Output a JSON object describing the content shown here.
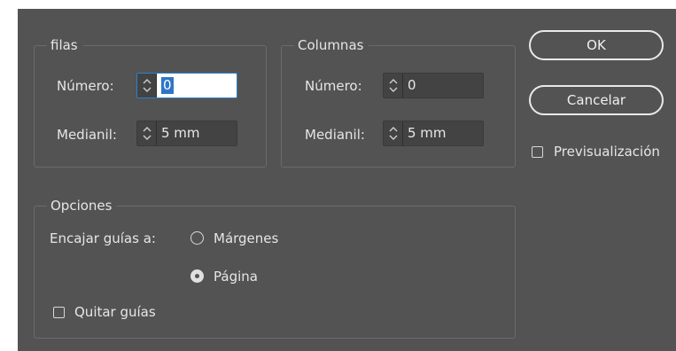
{
  "rows_group": {
    "legend": "filas",
    "number_label": "Número:",
    "number_value": "0",
    "gutter_label": "Medianil:",
    "gutter_value": "5 mm"
  },
  "columns_group": {
    "legend": "Columnas",
    "number_label": "Número:",
    "number_value": "0",
    "gutter_label": "Medianil:",
    "gutter_value": "5 mm"
  },
  "buttons": {
    "ok": "OK",
    "cancel": "Cancelar"
  },
  "preview": {
    "label": "Previsualización",
    "checked": false
  },
  "options": {
    "legend": "Opciones",
    "fit_label": "Encajar guías a:",
    "fit_options": [
      "Márgenes",
      "Página"
    ],
    "fit_selected": "Página",
    "remove_guides": {
      "label": "Quitar guías",
      "checked": false
    }
  },
  "colors": {
    "dialog_bg": "#535353",
    "field_bg": "#434343",
    "selection": "#2e76c9"
  },
  "icons": {
    "stepper": "up-down-arrows-icon",
    "checkbox": "checkbox-icon",
    "radio": "radio-icon"
  }
}
